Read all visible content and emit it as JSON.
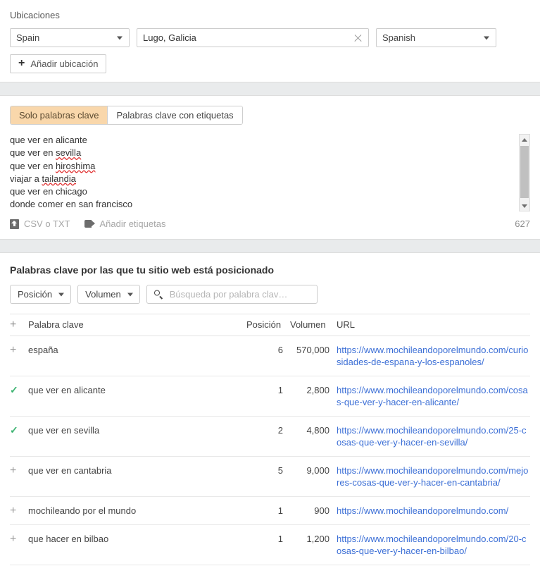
{
  "locations": {
    "label": "Ubicaciones",
    "country": "Spain",
    "city": "Lugo, Galicia",
    "language": "Spanish",
    "add_button": "Añadir ubicación",
    "add_icon": "plus-icon",
    "clear_icon": "close-icon",
    "caret_icon": "chevron-down-icon"
  },
  "keywords_panel": {
    "tabs": [
      {
        "label": "Solo palabras clave",
        "active": true
      },
      {
        "label": "Palabras clave con etiquetas",
        "active": false
      }
    ],
    "lines": [
      {
        "pre": "que ver en alicante",
        "mis": "",
        "post": ""
      },
      {
        "pre": "que ver en ",
        "mis": "sevilla",
        "post": ""
      },
      {
        "pre": "que ver en ",
        "mis": "hiroshima",
        "post": ""
      },
      {
        "pre": "viajar a ",
        "mis": "tailandia",
        "post": ""
      },
      {
        "pre": "que ver en chicago",
        "mis": "",
        "post": ""
      },
      {
        "pre": "donde comer en san francisco",
        "mis": "",
        "post": ""
      }
    ],
    "upload_label": "CSV o TXT",
    "upload_icon": "upload-icon",
    "tags_label": "Añadir etiquetas",
    "tags_icon": "tag-icon",
    "count": "627",
    "scrollbar_up_icon": "caret-up-icon",
    "scrollbar_down_icon": "caret-down-icon"
  },
  "ranked": {
    "title": "Palabras clave por las que tu sitio web está posicionado",
    "filters": [
      {
        "label": "Posición"
      },
      {
        "label": "Volumen"
      }
    ],
    "search_placeholder": "Búsqueda por palabra clav…",
    "search_value": "",
    "search_icon": "search-icon",
    "columns": {
      "add": "+",
      "keyword": "Palabra clave",
      "position": "Posición",
      "volume": "Volumen",
      "url": "URL"
    },
    "rows": [
      {
        "state": "plus",
        "keyword": "españa",
        "position": "6",
        "volume": "570,000",
        "url": "https://www.mochileandoporelmundo.com/curiosidades-de-espana-y-los-espanoles/"
      },
      {
        "state": "check",
        "keyword": "que ver en alicante",
        "position": "1",
        "volume": "2,800",
        "url": "https://www.mochileandoporelmundo.com/cosas-que-ver-y-hacer-en-alicante/"
      },
      {
        "state": "check",
        "keyword": "que ver en sevilla",
        "position": "2",
        "volume": "4,800",
        "url": "https://www.mochileandoporelmundo.com/25-cosas-que-ver-y-hacer-en-sevilla/"
      },
      {
        "state": "plus",
        "keyword": "que ver en cantabria",
        "position": "5",
        "volume": "9,000",
        "url": "https://www.mochileandoporelmundo.com/mejores-cosas-que-ver-y-hacer-en-cantabria/"
      },
      {
        "state": "plus",
        "keyword": "mochileando por el mundo",
        "position": "1",
        "volume": "900",
        "url": "https://www.mochileandoporelmundo.com/"
      },
      {
        "state": "plus",
        "keyword": "que hacer en bilbao",
        "position": "1",
        "volume": "1,200",
        "url": "https://www.mochileandoporelmundo.com/20-cosas-que-ver-y-hacer-en-bilbao/"
      }
    ]
  },
  "colors": {
    "tab_active_bg": "#f9d7ab",
    "link": "#3c6fd6",
    "check_green": "#3cb371",
    "band_gray": "#e9ebec",
    "misspell_red": "#e03232"
  }
}
